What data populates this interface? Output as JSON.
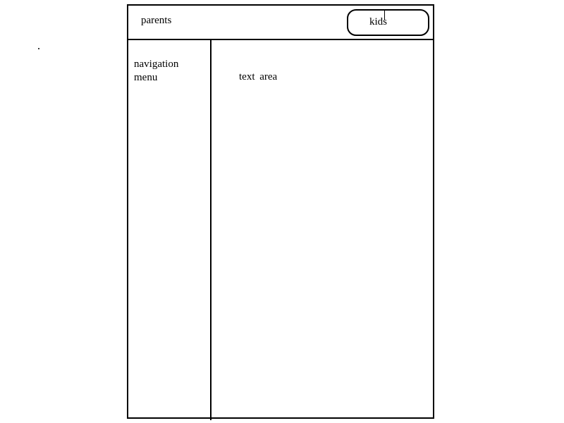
{
  "header": {
    "parents_label": "parents",
    "kids_label": "kids"
  },
  "sidebar": {
    "label": "navigation\nmenu"
  },
  "main": {
    "label": "text  area"
  },
  "colors": {
    "line": "#000000",
    "background": "#ffffff"
  }
}
